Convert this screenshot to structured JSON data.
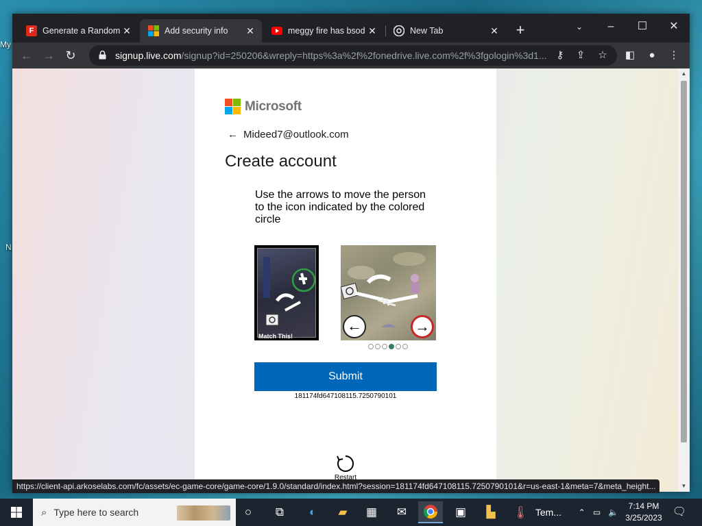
{
  "desktop": {
    "labels": [
      "My",
      "N"
    ]
  },
  "browser": {
    "tabs": [
      {
        "title": "Generate a Random N",
        "favicon": "F",
        "favicon_color": "#e0271a"
      },
      {
        "title": "Add security info",
        "favicon": "microsoft-logo"
      },
      {
        "title": "meggy fire has bsod",
        "favicon": "youtube-logo",
        "favicon_color": "#ff0000"
      },
      {
        "title": "New Tab",
        "favicon": "chrome-logo"
      }
    ],
    "active_tab": 1,
    "address": {
      "host": "signup.live.com",
      "path": "/signup?id=250206&wreply=https%3a%2f%2fonedrive.live.com%2f%3fgologin%3d1..."
    },
    "status_url": "https://client-api.arkoselabs.com/fc/assets/ec-game-core/game-core/1.9.0/standard/index.html?session=181174fd647108115.7250790101&r=us-east-1&meta=7&meta_height..."
  },
  "page": {
    "brand": "Microsoft",
    "brand_colors": [
      "#f25022",
      "#7fba00",
      "#00a4ef",
      "#ffb900"
    ],
    "identity": "Mideed7@outlook.com",
    "heading": "Create account",
    "instructions": "Use the arrows to move the person to the icon indicated by the colored circle",
    "match_label": "Match This!",
    "puzzle_progress": {
      "total": 6,
      "current": 4
    },
    "submit_label": "Submit",
    "session_id": "181174fd647108115.7250790101",
    "restart_label": "Restart",
    "accent": "#0067b8"
  },
  "taskbar": {
    "search_placeholder": "Type here to search",
    "pinned_label": "Tem...",
    "time": "7:14 PM",
    "date": "3/25/2023"
  }
}
